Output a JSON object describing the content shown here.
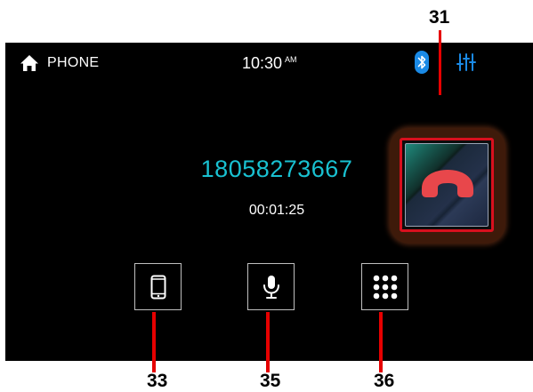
{
  "status_bar": {
    "home_icon": "home-icon",
    "app_title": "PHONE",
    "time": "10:30",
    "time_suffix": "AM",
    "bluetooth_icon": "bluetooth-icon",
    "equalizer_icon": "equalizer-icon"
  },
  "call": {
    "phone_number": "18058273667",
    "duration": "00:01:25"
  },
  "controls": {
    "end_call_icon": "end-call-icon",
    "handset_icon": "smartphone-icon",
    "microphone_icon": "microphone-icon",
    "keypad_icon": "keypad-icon"
  },
  "callouts": {
    "end_call": "31",
    "handset": "33",
    "microphone": "35",
    "keypad": "36"
  },
  "colors": {
    "screen_background": "#000000",
    "phone_number": "#19c1d1",
    "accent_blue": "#1a8ae6",
    "end_call_red": "#e8474b",
    "callout_red": "#e60000"
  }
}
